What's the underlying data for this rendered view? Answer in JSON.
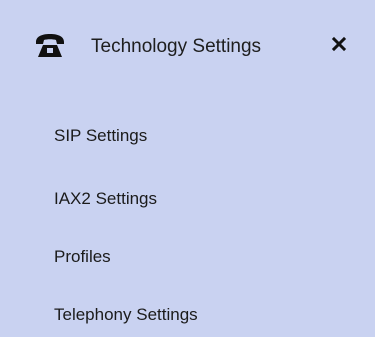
{
  "panel": {
    "background": "#c9d2f1",
    "header": {
      "icon": "telephone-icon",
      "title": "Technology Settings",
      "close_icon": "close-icon"
    },
    "items": [
      {
        "label": "SIP Settings"
      },
      {
        "label": "IAX2 Settings"
      },
      {
        "label": "Profiles"
      },
      {
        "label": "Telephony Settings"
      }
    ]
  }
}
